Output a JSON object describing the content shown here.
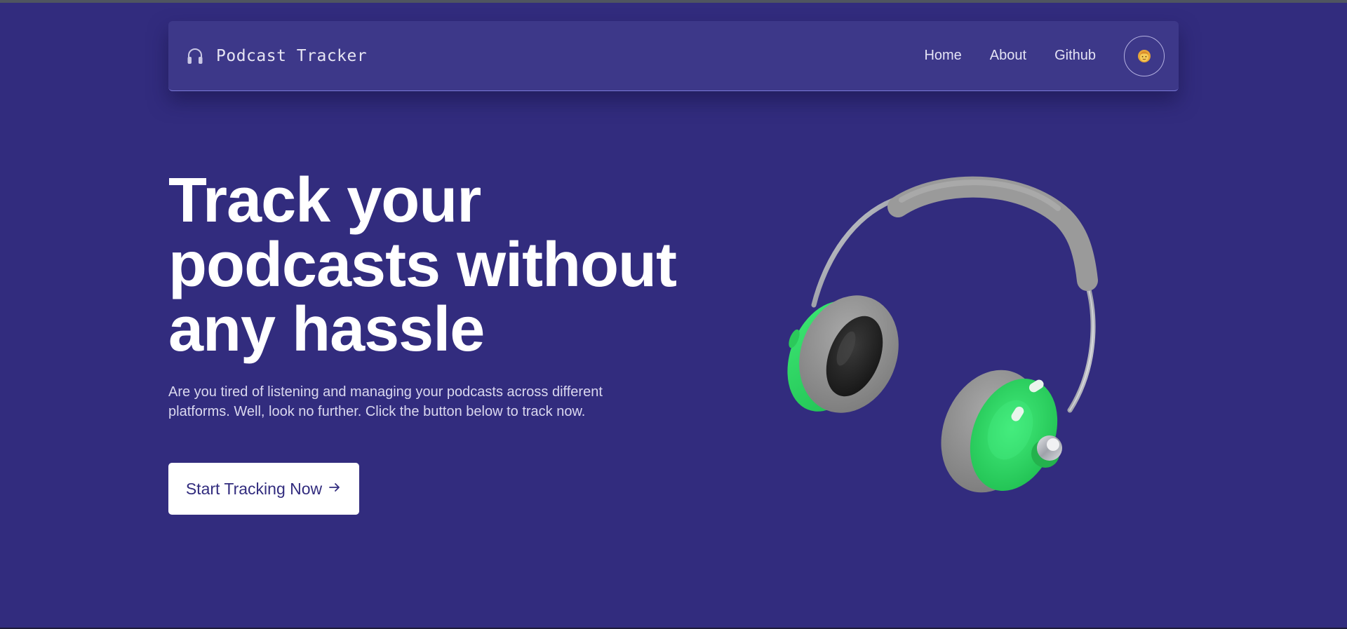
{
  "navbar": {
    "brand_icon": "headphones-icon",
    "brand_title": "Podcast Tracker",
    "links": [
      {
        "label": "Home"
      },
      {
        "label": "About"
      },
      {
        "label": "Github"
      }
    ],
    "avatar_icon": "user-avatar-emoji"
  },
  "hero": {
    "title": "Track your podcasts without any hassle",
    "description": "Are you tired of listening and managing your podcasts across different platforms. Well, look no further. Click the button below to track now.",
    "cta_label": "Start Tracking Now",
    "cta_icon": "arrow-right-icon",
    "illustration": "green-headphones-illustration"
  },
  "colors": {
    "background": "#322c7e",
    "navbar": "#3d3889",
    "headphone_green": "#2fd35d",
    "headphone_grey": "#9a9a9a",
    "button_bg": "#ffffff"
  }
}
